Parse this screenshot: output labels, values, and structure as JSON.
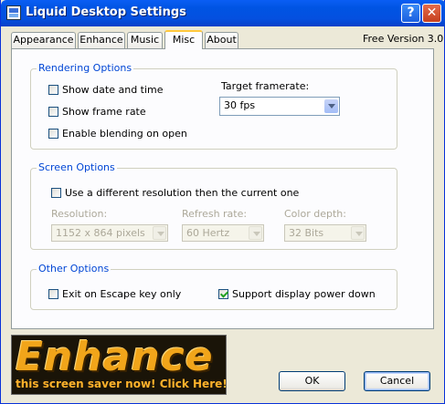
{
  "window": {
    "title": "Liquid Desktop Settings",
    "help_label": "?",
    "close_label": "✕"
  },
  "tabs": [
    {
      "label": "Appearance",
      "active": false
    },
    {
      "label": "Enhance",
      "active": false
    },
    {
      "label": "Music",
      "active": false
    },
    {
      "label": "Misc",
      "active": true
    },
    {
      "label": "About",
      "active": false
    }
  ],
  "version_label": "Free Version 3.0",
  "rendering": {
    "legend": "Rendering Options",
    "show_date": {
      "label": "Show date and time",
      "checked": false
    },
    "show_framerate": {
      "label": "Show frame rate",
      "checked": false
    },
    "blending": {
      "label": "Enable blending on open",
      "checked": false
    },
    "framerate_label": "Target framerate:",
    "framerate_value": "30 fps"
  },
  "screen": {
    "legend": "Screen Options",
    "different_res": {
      "label": "Use a different resolution then the current one",
      "checked": false
    },
    "resolution_label": "Resolution:",
    "resolution_value": "1152 x 864 pixels",
    "refresh_label": "Refresh rate:",
    "refresh_value": "60 Hertz",
    "depth_label": "Color depth:",
    "depth_value": "32 Bits"
  },
  "other": {
    "legend": "Other Options",
    "exit_escape": {
      "label": "Exit on Escape key only",
      "checked": false
    },
    "power_down": {
      "label": "Support display power down",
      "checked": true
    }
  },
  "banner": {
    "title": "Enhance",
    "subtitle": "this screen saver now!  Click Here!"
  },
  "buttons": {
    "ok": "OK",
    "cancel": "Cancel"
  },
  "colors": {
    "titlebar": "#0054e3",
    "group_legend": "#0046d5",
    "banner_text": "#f1a51a"
  }
}
